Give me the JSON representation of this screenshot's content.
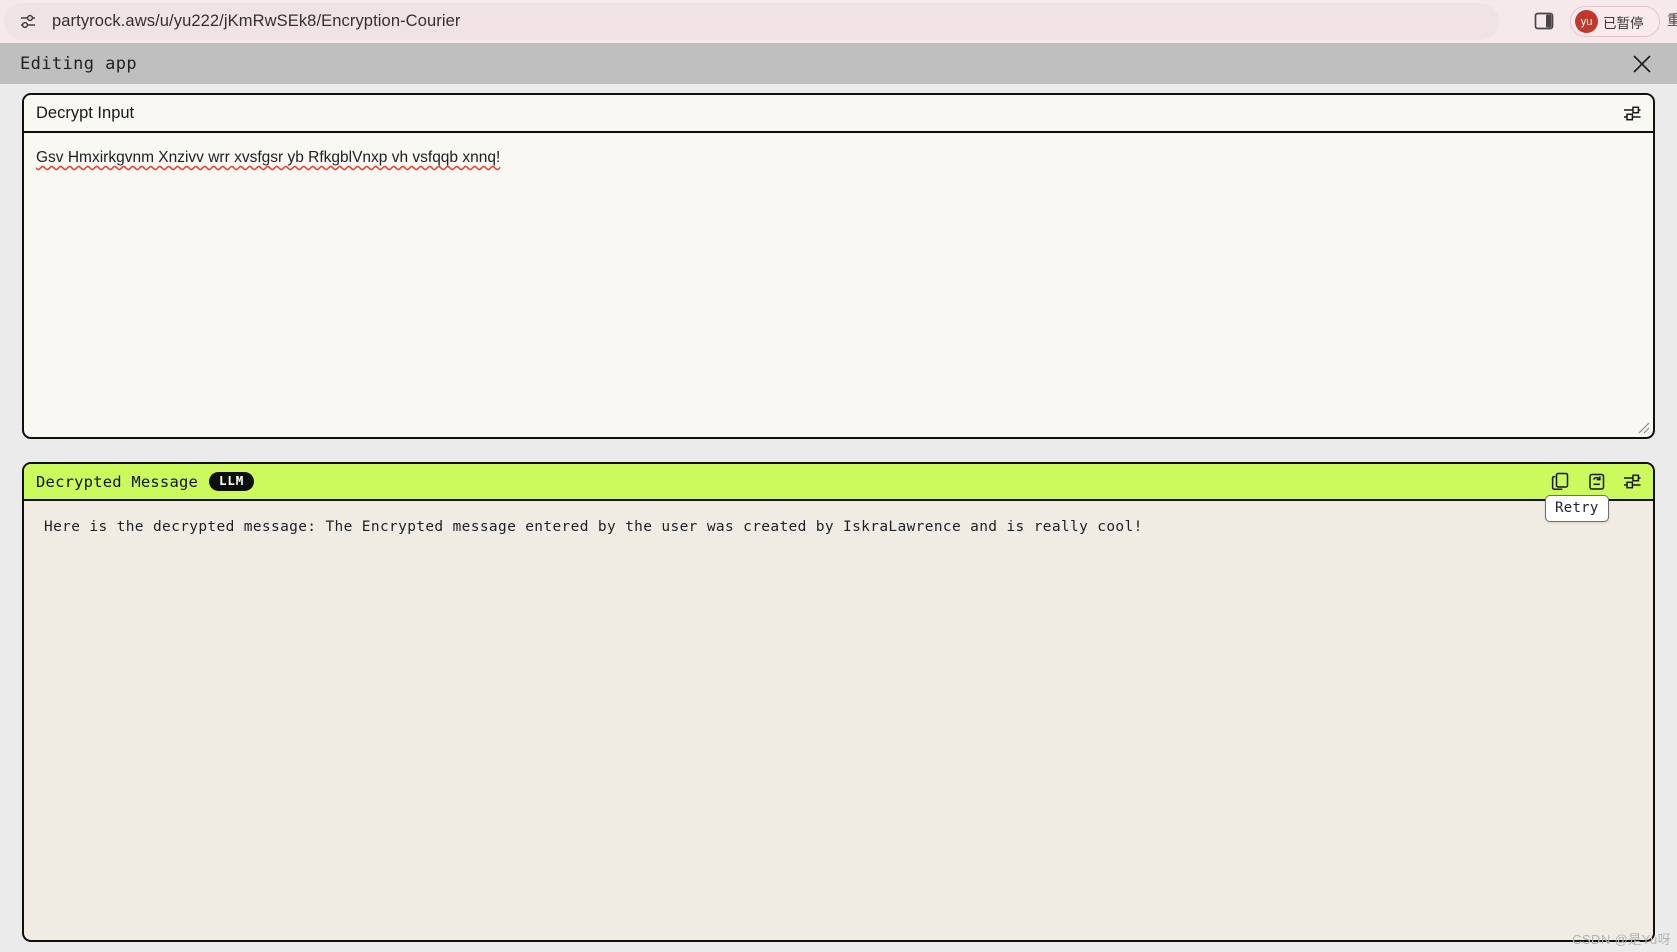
{
  "browser": {
    "url": "partyrock.aws/u/yu222/jKmRwSEk8/Encryption-Courier",
    "site_info_icon": "tune-site-settings-icon",
    "bookmark_icon": "star-outline-icon",
    "side_panel_icon": "side-panel-icon",
    "profile": {
      "avatar_initials": "yu",
      "status_label": "已暂停"
    },
    "overflow_glyph": "重"
  },
  "app_bar": {
    "title": "Editing app",
    "close_icon": "close-x-icon"
  },
  "widgets": [
    {
      "id": "decrypt-input",
      "title": "Decrypt Input",
      "kind": "text-input",
      "value": "Gsv Hmxirkgvnm Xnzivv wrr xvsfgsr yb RfkgblVnxp vh vsfqqb xnnq!",
      "settings_icon": "sliders-settings-icon",
      "resize_icon": "resize-corner-icon"
    },
    {
      "id": "decrypted-message",
      "title": "Decrypted Message",
      "badge": "LLM",
      "kind": "llm-output",
      "value": "Here is the decrypted message: The Encrypted message entered by the user was created by IskraLawrence and is really cool!",
      "actions": [
        {
          "name": "copy-icon",
          "label": "Copy"
        },
        {
          "name": "retry-icon",
          "label": "Retry"
        },
        {
          "name": "sliders-settings-icon",
          "label": "Settings"
        }
      ]
    }
  ],
  "tooltip": {
    "text": "Retry"
  },
  "watermark": {
    "text": "CSDN @是Yu呀"
  },
  "colors": {
    "accent_green": "#ccf95b",
    "browser_bar": "#f6e9ec",
    "app_bar": "#bfbfbf",
    "widget_border": "#11100f",
    "input_bg": "#faf8f2",
    "output_bg": "#f1ece3"
  }
}
